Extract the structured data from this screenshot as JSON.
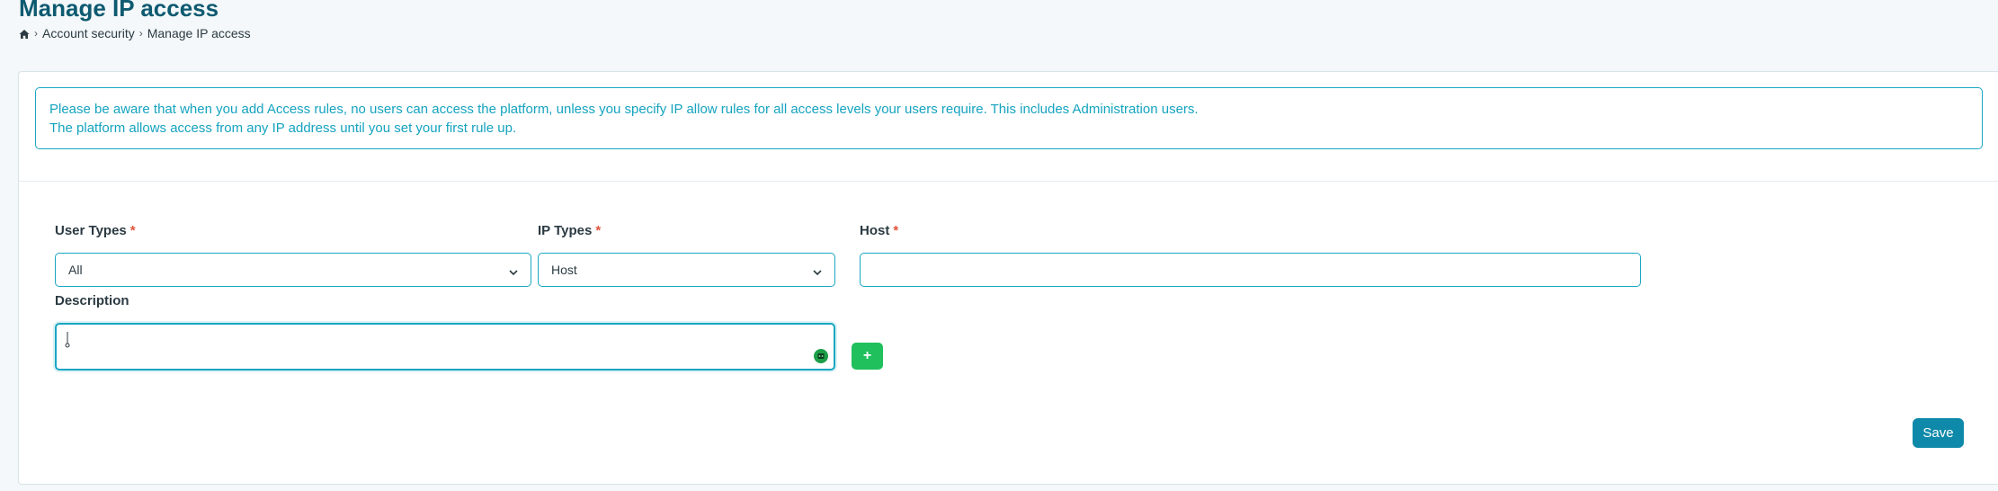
{
  "page": {
    "title": "Manage IP access"
  },
  "breadcrumb": {
    "items": [
      "Account security",
      "Manage IP access"
    ]
  },
  "notice": {
    "line1": "Please be aware that when you add Access rules, no users can access the platform, unless you specify IP allow rules for all access levels your users require. This includes Administration users.",
    "line2": "The platform allows access from any IP address until you set your first rule up."
  },
  "form": {
    "required_mark": "*",
    "user_types": {
      "label": "User Types",
      "value": "All"
    },
    "ip_types": {
      "label": "IP Types",
      "value": "Host"
    },
    "host": {
      "label": "Host",
      "value": ""
    },
    "description": {
      "label": "Description",
      "value": ""
    },
    "add_label": "+",
    "save_label": "Save"
  },
  "colors": {
    "accent": "#1aa6c2",
    "title": "#0e5a70",
    "add_button": "#20c05c",
    "save_button": "#0f89a9",
    "required": "#e0533d"
  },
  "icons": {
    "home": "home-icon",
    "breadcrumb_separator": "chevron-right-icon",
    "dropdown": "chevron-down-icon",
    "assist": "assist-icon"
  }
}
